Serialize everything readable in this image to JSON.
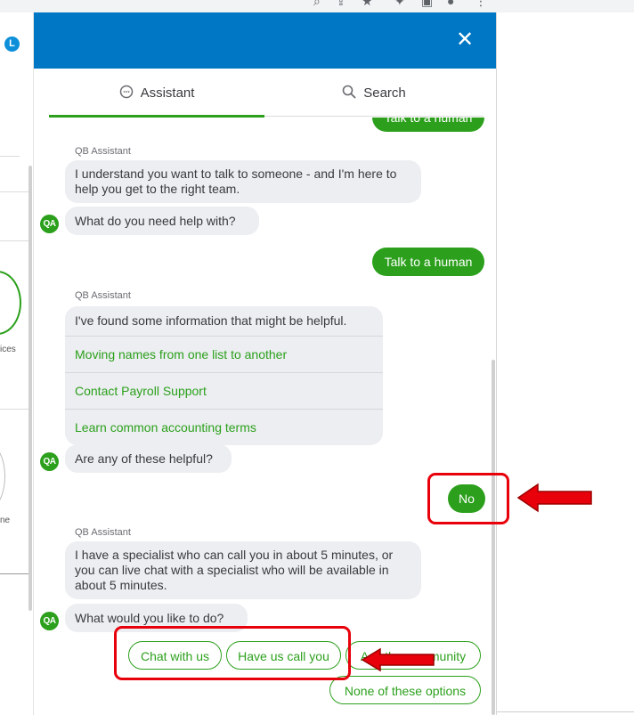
{
  "background": {
    "avatar_letter": "L",
    "left_label_1": "ices",
    "left_label_2": "ne"
  },
  "header": {
    "close_icon": "close-icon"
  },
  "tabs": {
    "assistant": "Assistant",
    "search": "Search"
  },
  "messages": {
    "top_user_cut": "Talk to a human",
    "label_1": "QB Assistant",
    "bot_1": "I understand you want to talk to someone - and I'm here to help you get to the right team.",
    "bot_2": "What do you need help with?",
    "user_1": "Talk to a human",
    "label_2": "QB Assistant",
    "info_head": "I've found some information that might be helpful.",
    "links": [
      "Moving names from one list to another",
      "Contact Payroll Support",
      "Learn common accounting terms"
    ],
    "bot_3": "Are any of these helpful?",
    "user_2": "No",
    "label_3": "QB Assistant",
    "bot_4": "I have a specialist who can call you in about 5 minutes, or you can live chat with a specialist who will be available in about 5 minutes.",
    "bot_5": "What would you like to do?",
    "avatar_text": "QA"
  },
  "options": {
    "chat": "Chat with us",
    "call": "Have us call you",
    "community": "Ask the community",
    "none": "None of these options"
  },
  "colors": {
    "header_blue": "#0077c5",
    "brand_green": "#2ca01c",
    "annotation_red": "#e8000b"
  }
}
